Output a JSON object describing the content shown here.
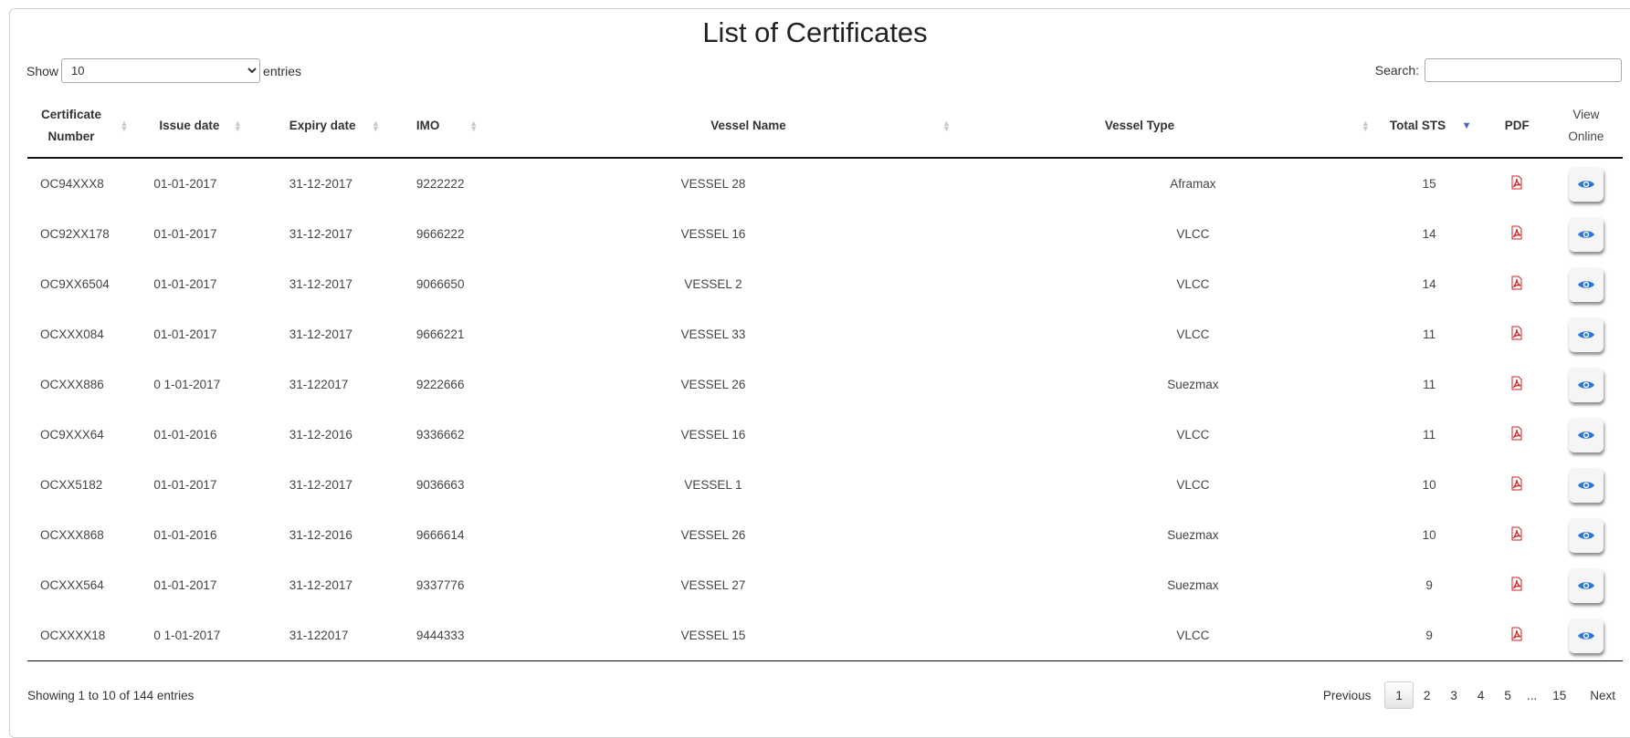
{
  "title": "List of Certificates",
  "length_control": {
    "show_label": "Show",
    "selected": "10",
    "entries_label": "entries"
  },
  "search": {
    "label": "Search:",
    "value": ""
  },
  "columns": [
    "Certificate Number",
    "Issue date",
    "Expiry date",
    "IMO",
    "Vessel Name",
    "Vessel Type",
    "Total STS",
    "PDF",
    "View Online"
  ],
  "columns_split": {
    "cert": [
      "Certificate",
      "Number"
    ],
    "view": [
      "View",
      "Online"
    ]
  },
  "rows": [
    {
      "cert": "OC94XXX8",
      "issue": "01-01-2017",
      "expiry": "31-12-2017",
      "imo": "9222222",
      "vessel": "VESSEL 28",
      "type": "Aframax",
      "sts": "15"
    },
    {
      "cert": "OC92XX178",
      "issue": "01-01-2017",
      "expiry": "31-12-2017",
      "imo": "9666222",
      "vessel": "VESSEL 16",
      "type": "VLCC",
      "sts": "14"
    },
    {
      "cert": "OC9XX6504",
      "issue": "01-01-2017",
      "expiry": "31-12-2017",
      "imo": "9066650",
      "vessel": "VESSEL 2",
      "type": "VLCC",
      "sts": "14"
    },
    {
      "cert": "OCXXX084",
      "issue": "01-01-2017",
      "expiry": "31-12-2017",
      "imo": "9666221",
      "vessel": "VESSEL 33",
      "type": "VLCC",
      "sts": "11"
    },
    {
      "cert": "OCXXX886",
      "issue": "0 1-01-2017",
      "expiry": "31-122017",
      "imo": "9222666",
      "vessel": "VESSEL 26",
      "type": "Suezmax",
      "sts": "11"
    },
    {
      "cert": "OC9XXX64",
      "issue": "01-01-2016",
      "expiry": "31-12-2016",
      "imo": "9336662",
      "vessel": "VESSEL 16",
      "type": "VLCC",
      "sts": "11"
    },
    {
      "cert": "OCXX5182",
      "issue": "01-01-2017",
      "expiry": "31-12-2017",
      "imo": "9036663",
      "vessel": "VESSEL 1",
      "type": "VLCC",
      "sts": "10"
    },
    {
      "cert": "OCXXX868",
      "issue": "01-01-2016",
      "expiry": "31-12-2016",
      "imo": "9666614",
      "vessel": "VESSEL 26",
      "type": "Suezmax",
      "sts": "10"
    },
    {
      "cert": "OCXXX564",
      "issue": "01-01-2017",
      "expiry": "31-12-2017",
      "imo": "9337776",
      "vessel": "VESSEL 27",
      "type": "Suezmax",
      "sts": "9"
    },
    {
      "cert": "OCXXXX18",
      "issue": "0 1-01-2017",
      "expiry": "31-122017",
      "imo": "9444333",
      "vessel": "VESSEL 15",
      "type": "VLCC",
      "sts": "9"
    }
  ],
  "info": "Showing 1 to 10 of 144 entries",
  "pagination": {
    "previous": "Previous",
    "pages": [
      "1",
      "2",
      "3",
      "4",
      "5"
    ],
    "ellipsis": "...",
    "last": "15",
    "next": "Next",
    "current": "1"
  },
  "colors": {
    "pdf": "#cc2222",
    "eye": "#2a78d6",
    "sort_active": "#4a5fbf"
  },
  "icons": {
    "pdf": "pdf-icon",
    "view": "eye-icon",
    "sort": "sort-icon"
  }
}
